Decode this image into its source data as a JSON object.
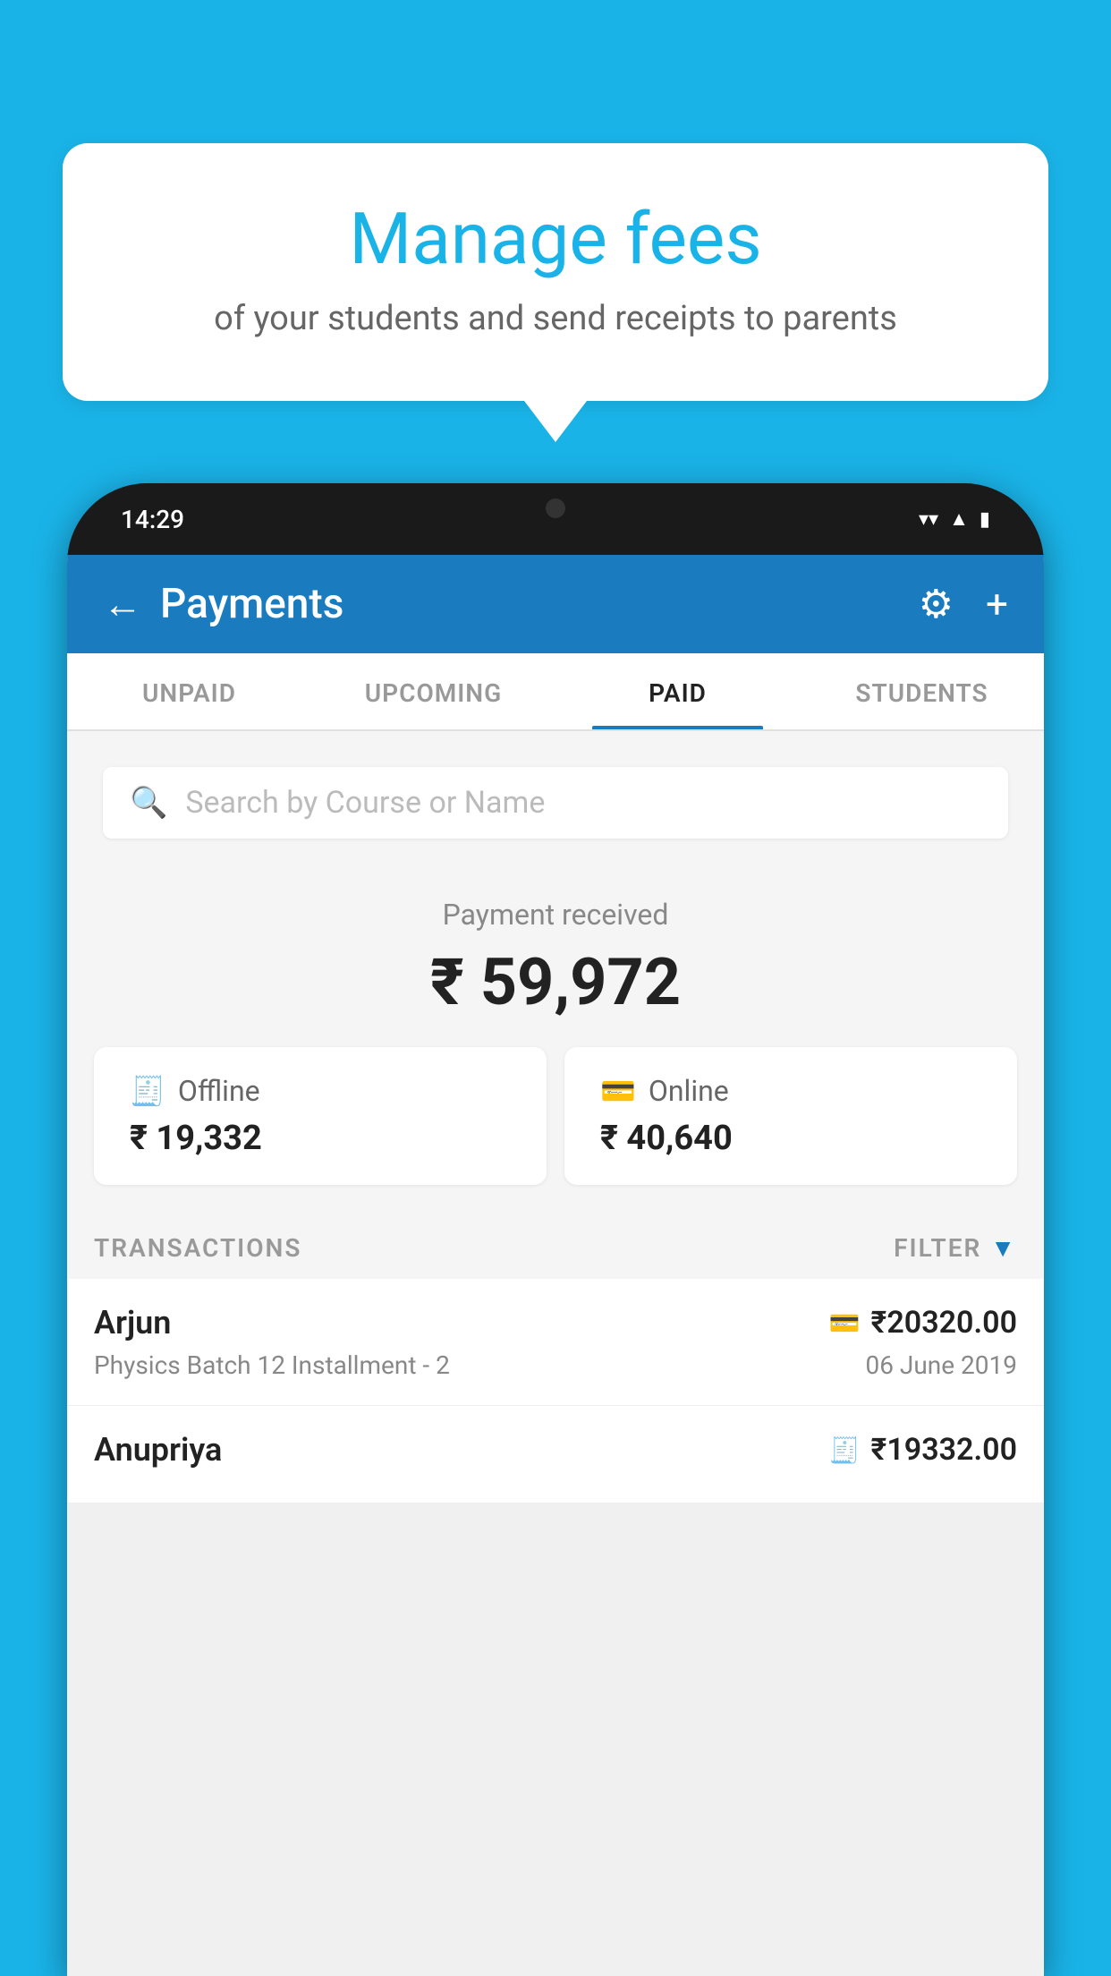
{
  "background_color": "#1ab3e8",
  "bubble": {
    "title": "Manage fees",
    "subtitle": "of your students and send receipts to parents"
  },
  "status_bar": {
    "time": "14:29",
    "icons": [
      "wifi",
      "signal",
      "battery"
    ]
  },
  "header": {
    "title": "Payments",
    "back_label": "←",
    "gear_label": "⚙",
    "plus_label": "+"
  },
  "tabs": [
    {
      "label": "UNPAID",
      "active": false
    },
    {
      "label": "UPCOMING",
      "active": false
    },
    {
      "label": "PAID",
      "active": true
    },
    {
      "label": "STUDENTS",
      "active": false
    }
  ],
  "search": {
    "placeholder": "Search by Course or Name"
  },
  "payment_summary": {
    "label": "Payment received",
    "total": "₹ 59,972",
    "offline": {
      "type": "Offline",
      "amount": "₹ 19,332"
    },
    "online": {
      "type": "Online",
      "amount": "₹ 40,640"
    }
  },
  "transactions": {
    "label": "TRANSACTIONS",
    "filter_label": "FILTER",
    "items": [
      {
        "name": "Arjun",
        "amount": "₹20320.00",
        "course": "Physics Batch 12 Installment - 2",
        "date": "06 June 2019",
        "payment_type": "online"
      },
      {
        "name": "Anupriya",
        "amount": "₹19332.00",
        "course": "",
        "date": "",
        "payment_type": "offline"
      }
    ]
  }
}
